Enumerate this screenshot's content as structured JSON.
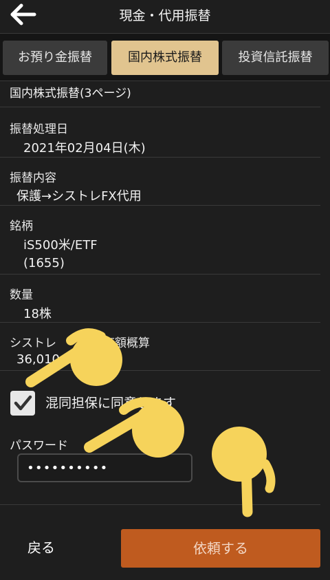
{
  "header": {
    "title": "現金・代用振替",
    "back_icon": "arrow-left-icon"
  },
  "tabs": [
    {
      "label": "お預り金振替",
      "active": false
    },
    {
      "label": "国内株式振替",
      "active": true
    },
    {
      "label": "投資信託振替",
      "active": false
    }
  ],
  "section_title": "国内株式振替(3ページ)",
  "fields": {
    "transfer_date": {
      "label": "振替処理日",
      "value": "2021年02月04日(木)"
    },
    "transfer_content": {
      "label": "振替内容",
      "value": "保護→シストレFX代用"
    },
    "stock": {
      "label": "銘柄",
      "name": "iS500米/ETF",
      "code": "(1655)"
    },
    "quantity": {
      "label": "数量",
      "value": "18株"
    },
    "valuation": {
      "label": "シストレ　　　評価額概算",
      "value": "36,010"
    }
  },
  "agreement": {
    "label": "混同担保に同意します",
    "checked": true
  },
  "password": {
    "label": "パスワード",
    "value": "••••••••••"
  },
  "footer": {
    "back_label": "戻る",
    "submit_label": "依頼する"
  },
  "colors": {
    "background": "#1e1e1e",
    "active_tab": "#e1c48f",
    "submit": "#bf5b1f",
    "pointer": "#f6d35b"
  }
}
